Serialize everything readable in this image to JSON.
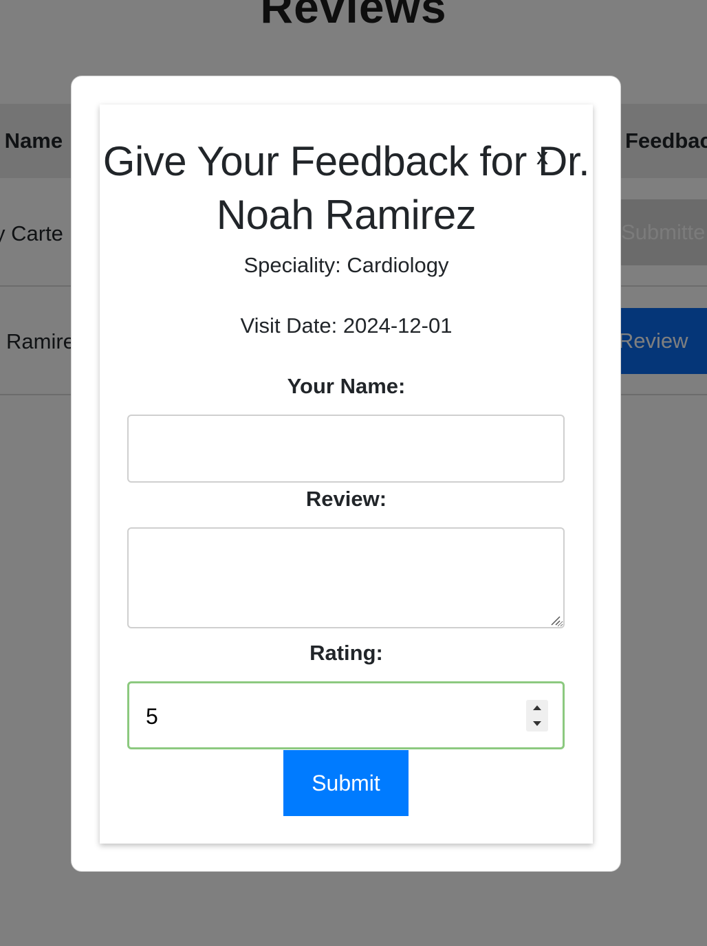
{
  "page": {
    "title": "Reviews",
    "table": {
      "headers": {
        "name": "r Name",
        "feedback": "Feedbac"
      },
      "rows": [
        {
          "name": "y Carte",
          "action": "Submitte"
        },
        {
          "name": "Ramire",
          "action": "e Review"
        }
      ]
    }
  },
  "modal": {
    "close_label": "x",
    "title": "Give Your Feedback for Dr. Noah Ramirez",
    "speciality": "Speciality: Cardiology",
    "visit_date": "Visit Date: 2024-12-01",
    "form": {
      "name_label": "Your Name:",
      "name_value": "",
      "review_label": "Review:",
      "review_value": "",
      "rating_label": "Rating:",
      "rating_value": "5",
      "submit_label": "Submit"
    }
  },
  "colors": {
    "overlay": "#808080",
    "primary_button": "#007bff",
    "rating_focus_border": "#8cc97f",
    "disabled_button": "#d6d6d6"
  }
}
